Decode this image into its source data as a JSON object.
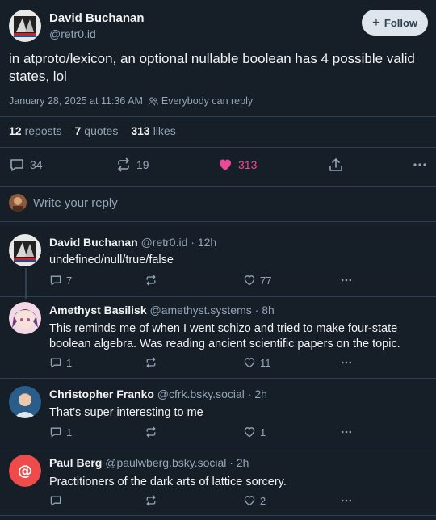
{
  "post": {
    "author_name": "David Buchanan",
    "author_handle": "@retr0.id",
    "follow_label": "Follow",
    "text": "in atproto/lexicon, an optional nullable boolean has 4 possible valid states, lol",
    "timestamp": "January 28, 2025 at 11:36 AM",
    "reply_setting": "Everybody can reply",
    "reposts_count": "12",
    "reposts_label": "reposts",
    "quotes_count": "7",
    "quotes_label": "quotes",
    "likes_count": "313",
    "likes_label": "likes",
    "reply_count": "34",
    "repost_count": "19",
    "like_count": "313",
    "like_color": "#ec4899"
  },
  "composer": {
    "placeholder": "Write your reply"
  },
  "replies": [
    {
      "name": "David Buchanan",
      "handle": "@retr0.id",
      "time": "· 12h",
      "text": "undefined/null/true/false",
      "replies": "7",
      "likes": "77"
    },
    {
      "name": "Amethyst Basilisk",
      "handle": "@amethyst.systems",
      "time": "· 8h",
      "text": "This reminds me of when I went schizo and tried to make four-state boolean algebra. Was reading ancient scientific papers on the topic.",
      "replies": "1",
      "likes": "11"
    },
    {
      "name": "Christopher Franko",
      "handle": "@cfrk.bsky.social",
      "time": "· 2h",
      "text": "That’s super interesting to me",
      "replies": "1",
      "likes": "1"
    },
    {
      "name": "Paul Berg",
      "handle": "@paulwberg.bsky.social",
      "time": "· 2h",
      "text": "Practitioners of the dark arts of lattice sorcery.",
      "replies": "",
      "likes": "2"
    }
  ]
}
